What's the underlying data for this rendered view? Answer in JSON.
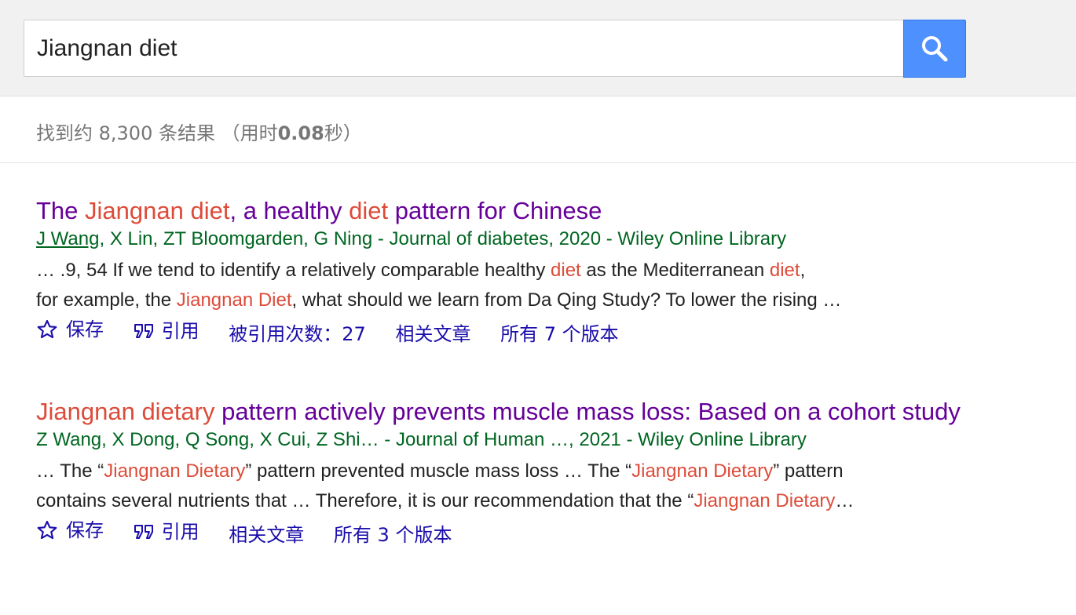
{
  "search": {
    "query": "Jiangnan diet"
  },
  "stats": {
    "prefix": "找到约 8,300 条结果 （用时",
    "time": "0.08",
    "suffix": "秒）"
  },
  "results": [
    {
      "title": [
        {
          "t": "The ",
          "h": false
        },
        {
          "t": "Jiangnan diet",
          "h": true
        },
        {
          "t": ", a healthy ",
          "h": false
        },
        {
          "t": "diet",
          "h": true
        },
        {
          "t": " pattern for Chinese",
          "h": false
        }
      ],
      "author_link": "J Wang",
      "meta_rest": ", X Lin, ZT Bloomgarden, G Ning - Journal of diabetes, 2020 - Wiley Online Library",
      "snippet_lines": [
        [
          {
            "t": "… .9, 54 If we tend to identify a relatively comparable healthy ",
            "h": false
          },
          {
            "t": "diet",
            "h": true
          },
          {
            "t": " as the Mediterranean ",
            "h": false
          },
          {
            "t": "diet",
            "h": true
          },
          {
            "t": ",",
            "h": false
          }
        ],
        [
          {
            "t": "for example, the ",
            "h": false
          },
          {
            "t": "Jiangnan Diet",
            "h": true
          },
          {
            "t": ", what should we learn from Da Qing Study? To lower the rising …",
            "h": false
          }
        ]
      ],
      "actions": [
        {
          "name": "save",
          "label": "保存",
          "icon": "star-icon"
        },
        {
          "name": "cite",
          "label": "引用",
          "icon": "quote-icon"
        },
        {
          "name": "cited-by",
          "label": "被引用次数：27"
        },
        {
          "name": "related",
          "label": "相关文章"
        },
        {
          "name": "versions",
          "label": "所有 7 个版本"
        }
      ]
    },
    {
      "title": [
        {
          "t": "Jiangnan dietary",
          "h": true
        },
        {
          "t": " pattern actively prevents muscle mass loss: Based on a cohort study",
          "h": false
        }
      ],
      "author_link": "",
      "meta_rest": "Z Wang, X Dong, Q Song, X Cui, Z Shi… - Journal of Human …, 2021 - Wiley Online Library",
      "snippet_lines": [
        [
          {
            "t": "… The “",
            "h": false
          },
          {
            "t": "Jiangnan Dietary",
            "h": true
          },
          {
            "t": "” pattern prevented muscle mass loss … The “",
            "h": false
          },
          {
            "t": "Jiangnan Dietary",
            "h": true
          },
          {
            "t": "” pattern",
            "h": false
          }
        ],
        [
          {
            "t": "contains several nutrients that … Therefore, it is our recommendation that the “",
            "h": false
          },
          {
            "t": "Jiangnan Dietary",
            "h": true
          },
          {
            "t": "…",
            "h": false
          }
        ]
      ],
      "actions": [
        {
          "name": "save",
          "label": "保存",
          "icon": "star-icon"
        },
        {
          "name": "cite",
          "label": "引用",
          "icon": "quote-icon"
        },
        {
          "name": "related",
          "label": "相关文章"
        },
        {
          "name": "versions",
          "label": "所有 3 个版本"
        }
      ]
    }
  ]
}
